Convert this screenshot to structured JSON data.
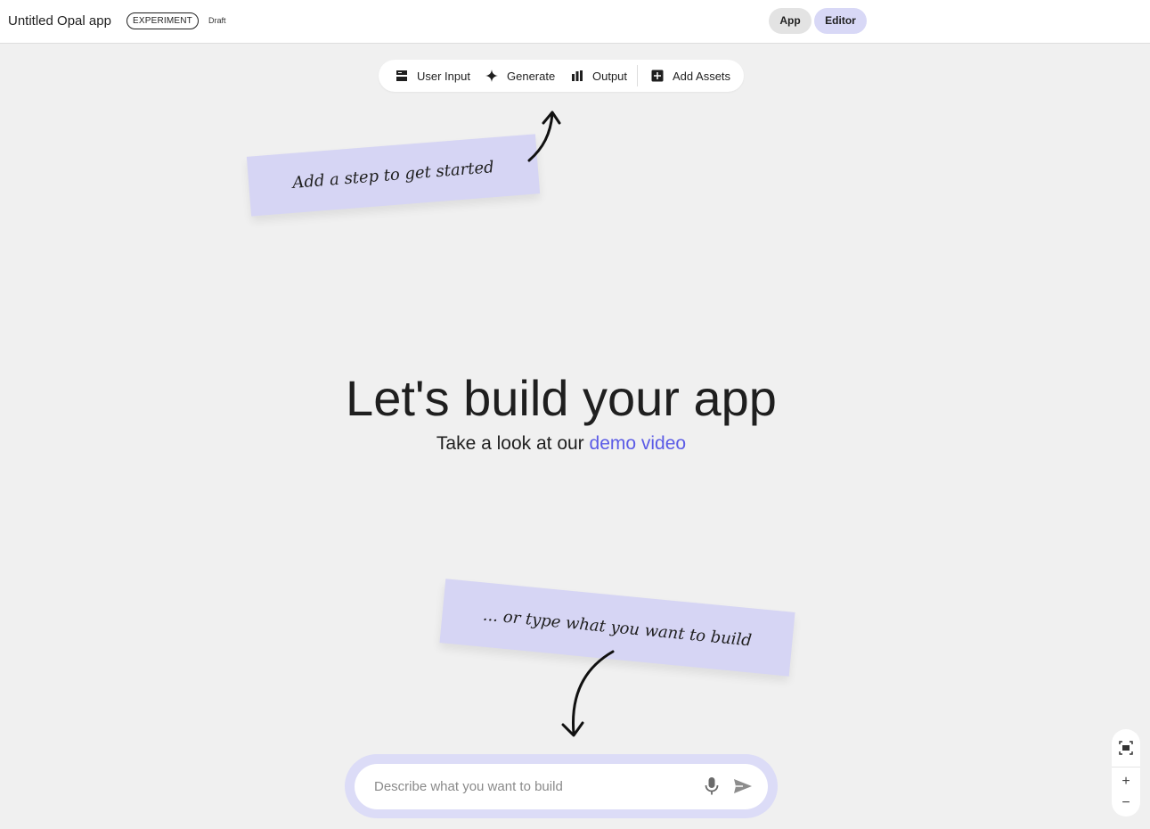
{
  "header": {
    "app_title": "Untitled Opal app",
    "experiment_badge": "EXPERIMENT",
    "status": "Draft",
    "view_toggle": {
      "app_label": "App",
      "editor_label": "Editor",
      "selected": "Editor"
    }
  },
  "toolbar": {
    "items": [
      {
        "label": "User Input",
        "icon": "user-input-icon"
      },
      {
        "label": "Generate",
        "icon": "sparkle-icon"
      },
      {
        "label": "Output",
        "icon": "output-icon"
      },
      {
        "label": "Add Assets",
        "icon": "add-assets-icon"
      }
    ]
  },
  "hints": {
    "top_note": "Add a step to get started",
    "bottom_note": "... or type what you want to build"
  },
  "hero": {
    "title": "Let's build your app",
    "subtitle_prefix": "Take a look at our ",
    "subtitle_link": "demo video"
  },
  "prompt": {
    "placeholder": "Describe what you want to build",
    "value": ""
  },
  "zoom": {
    "in_label": "+",
    "out_label": "−"
  },
  "colors": {
    "accent": "#5b5be6",
    "note_bg": "#d6d5f4",
    "editor_selected_bg": "#d8d8f6",
    "canvas_bg": "#f0f0f0"
  }
}
